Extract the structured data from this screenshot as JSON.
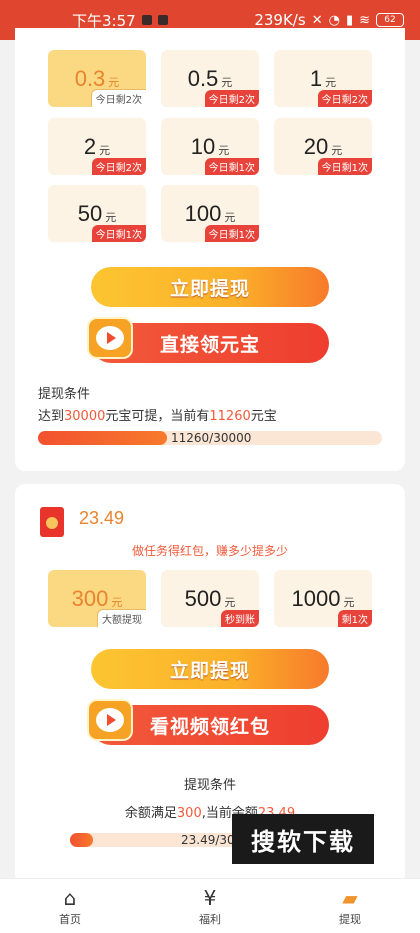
{
  "status_bar": {
    "time": "下午3:57",
    "net_speed": "239K/s",
    "battery": "62"
  },
  "withdraw_section": {
    "amount_tiles": [
      {
        "value": "0.3",
        "unit": "元",
        "badge": "今日剩2次",
        "selected": true
      },
      {
        "value": "0.5",
        "unit": "元",
        "badge": "今日剩2次",
        "selected": false
      },
      {
        "value": "1",
        "unit": "元",
        "badge": "今日剩2次",
        "selected": false
      },
      {
        "value": "2",
        "unit": "元",
        "badge": "今日剩2次",
        "selected": false
      },
      {
        "value": "10",
        "unit": "元",
        "badge": "今日剩1次",
        "selected": false
      },
      {
        "value": "20",
        "unit": "元",
        "badge": "今日剩1次",
        "selected": false
      },
      {
        "value": "50",
        "unit": "元",
        "badge": "今日剩1次",
        "selected": false
      },
      {
        "value": "100",
        "unit": "元",
        "badge": "今日剩1次",
        "selected": false
      }
    ],
    "withdraw_button": "立即提现",
    "claim_button": "直接领元宝",
    "condition_title": "提现条件",
    "condition_prefix": "达到",
    "condition_target": "30000",
    "condition_middle": "元宝可提，当前有",
    "condition_current": "11260",
    "condition_suffix": "元宝",
    "progress_label": "11260/30000",
    "progress_fraction": 0.3753
  },
  "redpacket_section": {
    "balance": "23.49",
    "hint": "做任务得红包，赚多少提多少",
    "amount_tiles": [
      {
        "value": "300",
        "unit": "元",
        "badge": "大额提现",
        "selected": true
      },
      {
        "value": "500",
        "unit": "元",
        "badge": "秒到账",
        "selected": false
      },
      {
        "value": "1000",
        "unit": "元",
        "badge": "剩1次",
        "selected": false
      }
    ],
    "withdraw_button": "立即提现",
    "video_button": "看视频领红包",
    "condition_title": "提现条件",
    "condition_prefix": "余额满足",
    "condition_target": "300",
    "condition_middle": ",当前余额",
    "condition_current": "23.49",
    "progress_label": "23.49/300",
    "progress_fraction": 0.0783
  },
  "watermark": "搜软下载",
  "tab_bar": {
    "tabs": [
      {
        "label": "首页",
        "icon": "home-icon",
        "active": false
      },
      {
        "label": "福利",
        "icon": "yuan-icon",
        "active": false
      },
      {
        "label": "提现",
        "icon": "wallet-icon",
        "active": true
      }
    ]
  },
  "colors": {
    "status_bar": "#e0452f",
    "accent_orange": "#e9832d",
    "accent_red": "#f25a3a",
    "tile_bg": "#fdf3e4",
    "tile_selected_bg": "#fbd983"
  }
}
